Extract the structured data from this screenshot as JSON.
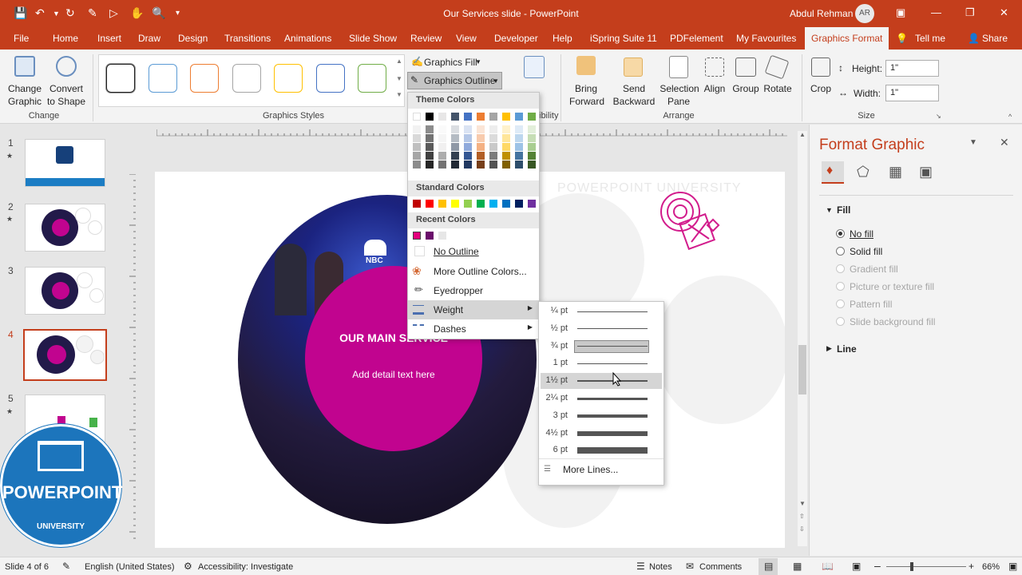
{
  "window": {
    "title": "Our Services slide  -  PowerPoint",
    "user": "Abdul Rehman",
    "avatar_initials": "AR"
  },
  "tabs": [
    "File",
    "Home",
    "Insert",
    "Draw",
    "Design",
    "Transitions",
    "Animations",
    "Slide Show",
    "Review",
    "View",
    "Developer",
    "Help",
    "iSpring Suite 11",
    "PDFelement",
    "My Favourites",
    "Graphics Format",
    "Tell me",
    "Share"
  ],
  "ribbon": {
    "change_graphic": "Change\nGraphic",
    "change_graphic_l1": "Change",
    "change_graphic_l2": "Graphic",
    "convert_l1": "Convert",
    "convert_l2": "to Shape",
    "group_change": "Change",
    "group_styles": "Graphics Styles",
    "graphics_fill": "Graphics Fill",
    "graphics_outline": "Graphics Outline",
    "alt_text": "Alt",
    "accessibility_fragment": "ibility",
    "bring_forward_l1": "Bring",
    "bring_forward_l2": "Forward",
    "send_backward_l1": "Send",
    "send_backward_l2": "Backward",
    "selection_pane_l1": "Selection",
    "selection_pane_l2": "Pane",
    "align": "Align",
    "group": "Group",
    "rotate": "Rotate",
    "group_arrange": "Arrange",
    "crop": "Crop",
    "height_label": "Height:",
    "height_value": "1\"",
    "width_label": "Width:",
    "width_value": "1\"",
    "group_size": "Size",
    "style_border_colors": [
      "#222222",
      "#5b9bd5",
      "#ed7d31",
      "#a5a5a5",
      "#ffc000",
      "#4472c4",
      "#70ad47"
    ]
  },
  "outline_menu": {
    "theme_colors_header": "Theme Colors",
    "standard_colors_header": "Standard Colors",
    "recent_colors_header": "Recent Colors",
    "theme_top_row": [
      "#ffffff",
      "#000000",
      "#e7e6e6",
      "#44546a",
      "#4472c4",
      "#ed7d31",
      "#a5a5a5",
      "#ffc000",
      "#5b9bd5",
      "#70ad47"
    ],
    "standard_colors": [
      "#c00000",
      "#ff0000",
      "#ffc000",
      "#ffff00",
      "#92d050",
      "#00b050",
      "#00b0f0",
      "#0070c0",
      "#002060",
      "#7030a0"
    ],
    "recent_colors": [
      "#e4007c",
      "#6a0d6b",
      "#e6e6e6"
    ],
    "no_outline": "No Outline",
    "more_outline_colors": "More Outline Colors...",
    "eyedropper": "Eyedropper",
    "weight": "Weight",
    "dashes": "Dashes"
  },
  "weight_menu": {
    "items": [
      {
        "label": "¼ pt",
        "pt": 0.25
      },
      {
        "label": "½ pt",
        "pt": 0.5
      },
      {
        "label": "¾ pt",
        "pt": 0.75
      },
      {
        "label": "1 pt",
        "pt": 1
      },
      {
        "label": "1½ pt",
        "pt": 1.5
      },
      {
        "label": "2¼ pt",
        "pt": 2.25
      },
      {
        "label": "3 pt",
        "pt": 3
      },
      {
        "label": "4½ pt",
        "pt": 4.5
      },
      {
        "label": "6 pt",
        "pt": 6
      }
    ],
    "selected": "¾ pt",
    "hovered": "1½ pt",
    "more_lines": "More Lines..."
  },
  "slides": {
    "numbers": [
      "1",
      "2",
      "3",
      "4",
      "5"
    ],
    "current": "4"
  },
  "slide_content": {
    "watermark": "POWERPOINT UNIVERSITY",
    "heading": "OUR MAIN SERVICE",
    "detail": "Add detail text here",
    "nbc": "NBC",
    "accent": "#c1048f"
  },
  "logo": {
    "line1": "POWERPOINT",
    "line2": "UNIVERSITY"
  },
  "format_pane": {
    "title": "Format Graphic",
    "fill_section": "Fill",
    "options": [
      {
        "label": "No fill",
        "checked": true,
        "enabled": true
      },
      {
        "label": "Solid fill",
        "checked": false,
        "enabled": true
      },
      {
        "label": "Gradient fill",
        "checked": false,
        "enabled": false
      },
      {
        "label": "Picture or texture fill",
        "checked": false,
        "enabled": false
      },
      {
        "label": "Pattern fill",
        "checked": false,
        "enabled": false
      },
      {
        "label": "Slide background fill",
        "checked": false,
        "enabled": false
      }
    ],
    "line_section": "Line"
  },
  "status": {
    "slide_of": "Slide 4 of 6",
    "language": "English (United States)",
    "accessibility": "Accessibility: Investigate",
    "notes": "Notes",
    "comments": "Comments",
    "zoom": "66%"
  }
}
